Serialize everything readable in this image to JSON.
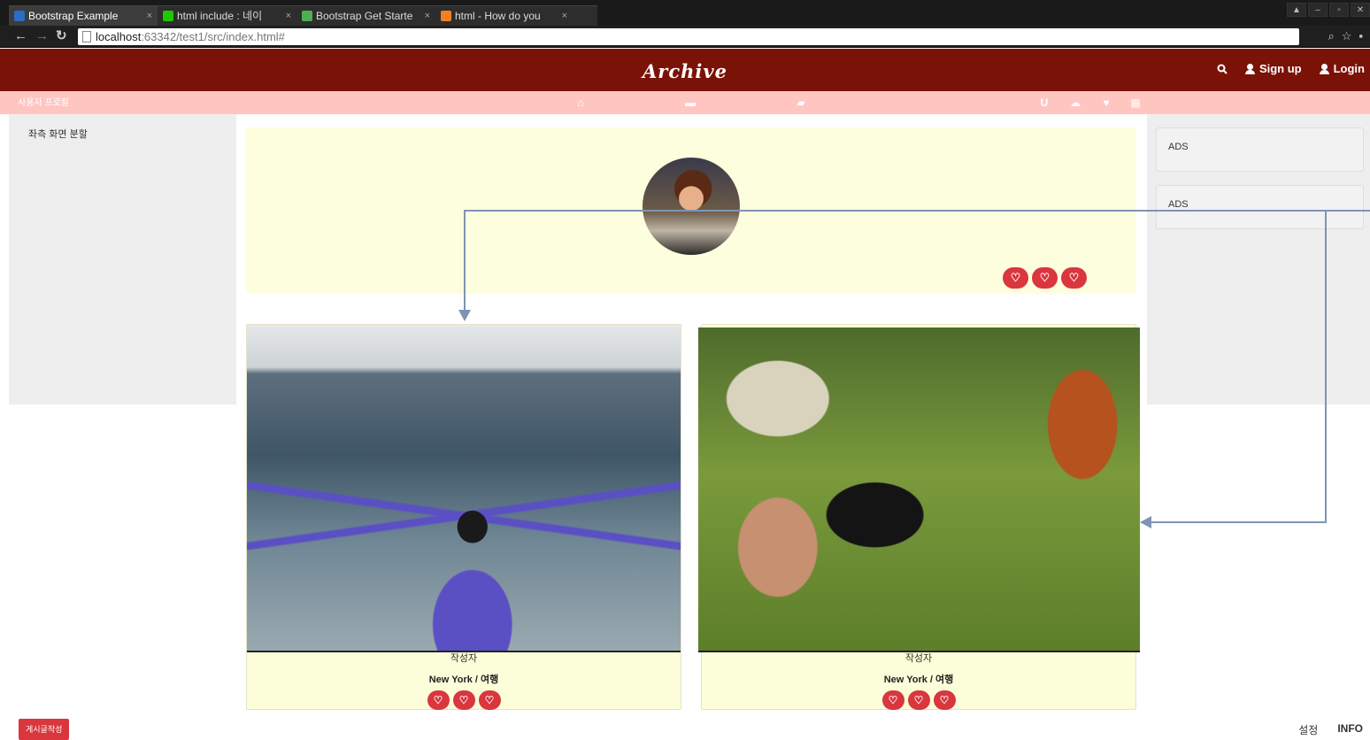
{
  "browser": {
    "tabs": [
      {
        "title": "Bootstrap Example",
        "active": true,
        "icon": "ws-icon",
        "icon_color": "#2b6cc4"
      },
      {
        "title": "html include : 네이",
        "active": false,
        "icon": "naver-icon",
        "icon_color": "#1ec800"
      },
      {
        "title": "Bootstrap Get Starte",
        "active": false,
        "icon": "w3-icon",
        "icon_color": "#4caf50"
      },
      {
        "title": "html - How do you",
        "active": false,
        "icon": "stackoverflow-icon",
        "icon_color": "#f48024"
      }
    ],
    "tab_close": "×",
    "url_host": "localhost",
    "url_path": ":63342/test1/src/index.html#"
  },
  "site": {
    "brand": "Archive",
    "nav": {
      "search_icon": "search-icon",
      "signup": "Sign up",
      "login": "Login"
    },
    "subbar": {
      "label": "사용자 프로필",
      "icons": [
        "home-icon",
        "comment-icon",
        "folder-icon",
        "magnet-icon",
        "cloud-icon",
        "heart-icon",
        "grid-icon"
      ]
    }
  },
  "left_panel": {
    "text": "좌측 화면 분할"
  },
  "right_panel": {
    "ads": [
      "ADS",
      "ADS"
    ]
  },
  "cards": [
    {
      "author": "작성자",
      "location": "New York / 여행"
    },
    {
      "author": "작성자",
      "location": "New York / 여행"
    }
  ],
  "footer": {
    "write_button": "게시글작성",
    "settings": "설정",
    "info": "INFO"
  },
  "colors": {
    "navbar": "#7a1208",
    "subbar": "#ffc6c1",
    "accent": "#d9363e",
    "card_bg": "#fcfed9",
    "arrow": "#7f94b3"
  }
}
